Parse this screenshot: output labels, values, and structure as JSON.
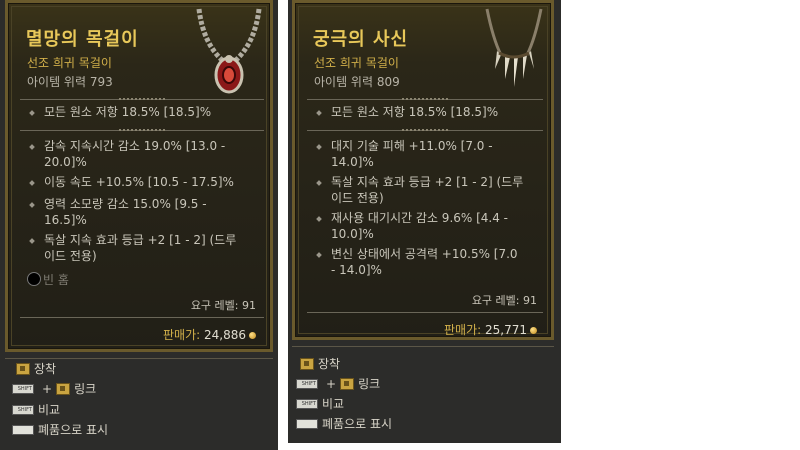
{
  "left": {
    "name": "멸망의 목걸이",
    "type": "선조 희귀 목걸이",
    "power": "아이템 위력 793",
    "implicit": "모든 원소 저항 18.5% [18.5]%",
    "affixes": [
      [
        "감속 지속시간 감소 19.0% [13.0 -",
        "20.0]%"
      ],
      [
        "이동 속도 +10.5% [10.5 - 17.5]%"
      ],
      [
        "영력 소모량 감소 15.0% [9.5 -",
        "16.5]%"
      ],
      [
        "독살 지속 효과 등급 +2 [1 - 2] (드루",
        "이드 전용)"
      ]
    ],
    "socket_label": "빈 홈",
    "required_level": "요구 레벨: 91",
    "sell_label": "판매가:",
    "sell_value": "24,886"
  },
  "right": {
    "name": "궁극의 사신",
    "type": "선조 희귀 목걸이",
    "power": "아이템 위력 809",
    "implicit": "모든 원소 저항 18.5% [18.5]%",
    "affixes": [
      [
        "대지 기술 피해 +11.0% [7.0 -",
        "14.0]%"
      ],
      [
        "독살 지속 효과 등급 +2 [1 - 2] (드루",
        "이드 전용)"
      ],
      [
        "재사용 대기시간 감소 9.6% [4.4 -",
        "10.0]%"
      ],
      [
        "변신 상태에서 공격력 +10.5% [7.0",
        "- 14.0]%"
      ]
    ],
    "required_level": "요구 레벨: 91",
    "sell_label": "판매가:",
    "sell_value": "25,771"
  },
  "hints": {
    "equip": "장착",
    "link": "링크",
    "compare": "비교",
    "show_junk": "폐품으로 표시",
    "shift_key": "SHIFT"
  }
}
